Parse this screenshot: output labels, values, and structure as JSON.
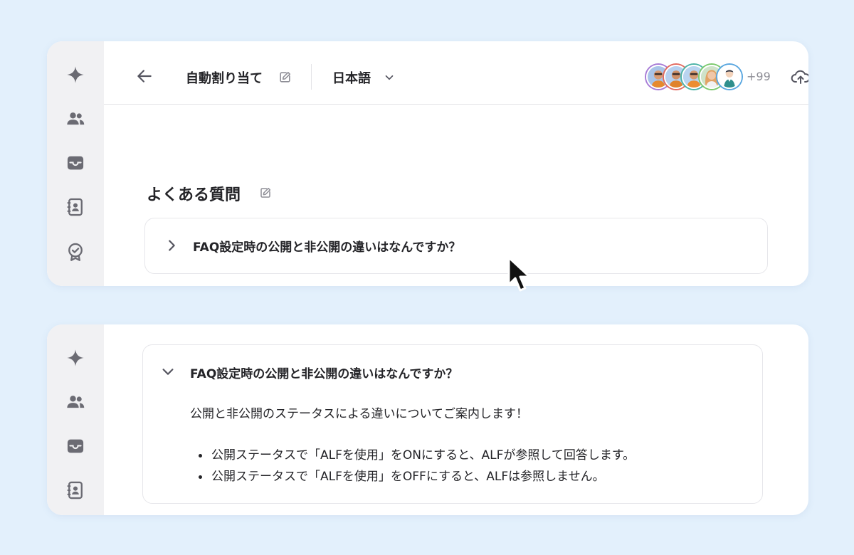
{
  "header": {
    "title": "自動割り当て",
    "language": "日本語",
    "member_count_more": "+99"
  },
  "section": {
    "title": "よくある質問"
  },
  "faq": {
    "question": "FAQ設定時の公開と非公開の違いはなんですか？",
    "answer_intro": "公開と非公開のステータスによる違いについてご案内します！",
    "answer_items": [
      "公開ステータスで「ALFを使用」をONにすると、ALFが参照して回答します。",
      "公開ステータスで「ALFを使用」をOFFにすると、ALFは参照しません。"
    ]
  },
  "sidebar": {
    "icons": [
      "sparkle-icon",
      "users-icon",
      "inbox-icon",
      "contact-book-icon",
      "badge-check-icon"
    ]
  },
  "colors": {
    "page_background": "#e3f0fc",
    "sidebar_background": "#f1f1f3",
    "text": "#242428",
    "muted_text": "#8e8e96",
    "icon_gray": "#6b6b73"
  }
}
